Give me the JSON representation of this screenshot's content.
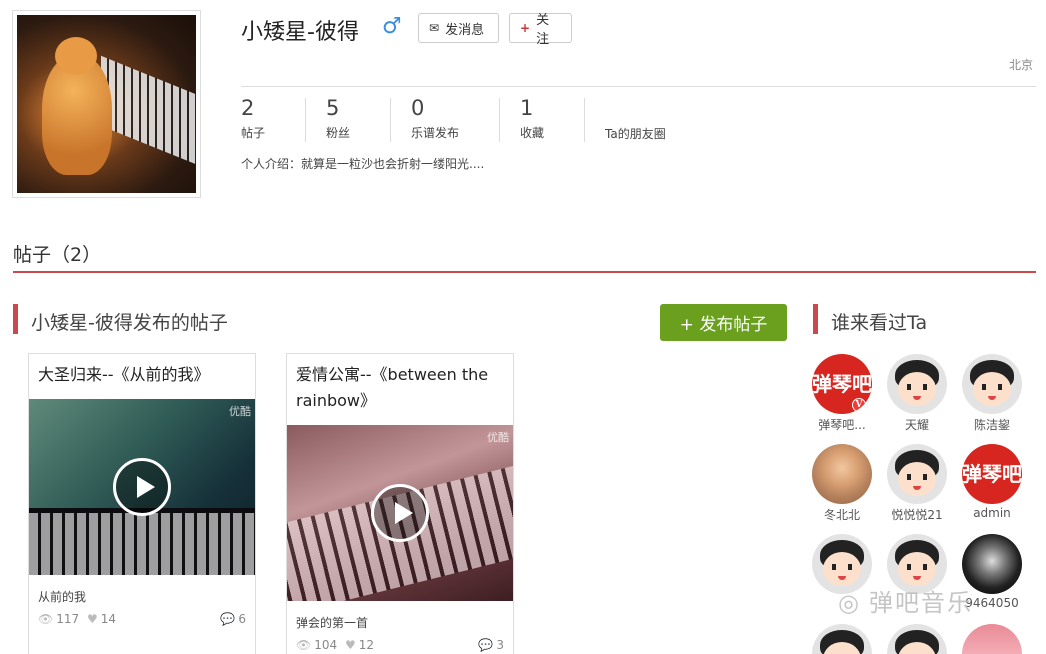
{
  "profile": {
    "name": "小矮星-彼得",
    "gender_symbol": "♂",
    "location": "北京",
    "intro": "个人介绍：就算是一粒沙也会折射一缕阳光...."
  },
  "actions": {
    "message_label": "发消息",
    "follow_label": "关注",
    "follow_prefix": "+"
  },
  "stats": [
    {
      "num": "2",
      "label": "帖子"
    },
    {
      "num": "5",
      "label": "粉丝"
    },
    {
      "num": "0",
      "label": "乐谱发布"
    },
    {
      "num": "1",
      "label": "收藏"
    },
    {
      "num": "",
      "label": "Ta的朋友圈"
    }
  ],
  "posts_section": {
    "title": "帖子（2）",
    "subtitle": "小矮星-彼得发布的帖子",
    "publish_label": "+ 发布帖子"
  },
  "posts": [
    {
      "title": "大圣归来--《从前的我》",
      "desc": "从前的我",
      "views": "117",
      "likes": "14",
      "comments": "6",
      "video_source": "优酷"
    },
    {
      "title": "爱情公寓--《between the rainbow》",
      "desc": "弹会的第一首",
      "views": "104",
      "likes": "12",
      "comments": "3",
      "video_source": "优酷"
    }
  ],
  "visitors": {
    "title": "谁来看过Ta",
    "items": [
      {
        "name": "弹琴吧...",
        "type": "logo"
      },
      {
        "name": "天耀",
        "type": "cartoon"
      },
      {
        "name": "陈洁鋆",
        "type": "cartoon"
      },
      {
        "name": "冬北北",
        "type": "photo"
      },
      {
        "name": "悦悦悦21",
        "type": "cartoon"
      },
      {
        "name": "admin",
        "type": "logo"
      },
      {
        "name": "",
        "type": "cartoon"
      },
      {
        "name": "",
        "type": "cartoon"
      },
      {
        "name": "9464050",
        "type": "anon"
      }
    ]
  },
  "logo_text": "弹琴吧",
  "watermark": "弹吧音乐",
  "colors": {
    "accent": "#c9494f",
    "publish": "#6aa01e",
    "gender": "#3a8ee0"
  }
}
